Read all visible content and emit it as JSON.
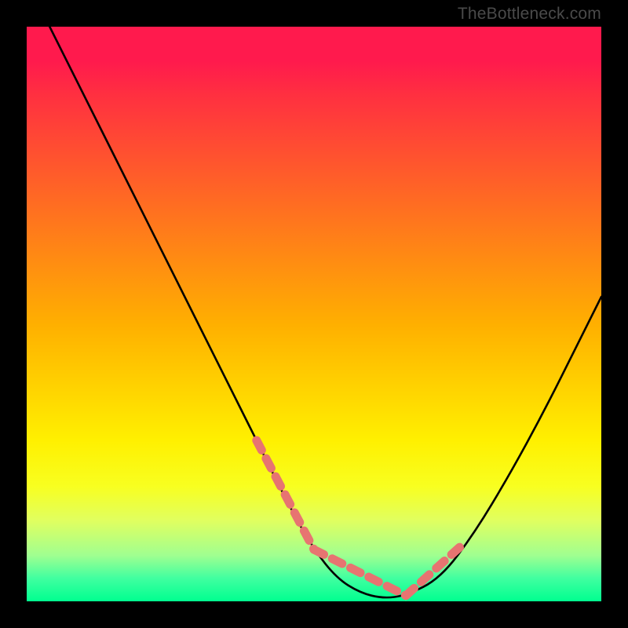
{
  "watermark": "TheBottleneck.com",
  "chart_data": {
    "type": "line",
    "title": "",
    "xlabel": "",
    "ylabel": "",
    "xlim": [
      0,
      100
    ],
    "ylim": [
      0,
      100
    ],
    "series": [
      {
        "name": "main-curve",
        "color": "#000000",
        "x": [
          4,
          10,
          16,
          22,
          28,
          34,
          40,
          46,
          50,
          54,
          58,
          62,
          66,
          72,
          78,
          84,
          90,
          96,
          100
        ],
        "y": [
          100,
          88,
          76,
          64,
          52,
          40,
          28,
          16,
          9,
          4,
          1.5,
          0.5,
          1,
          4,
          12,
          22,
          33,
          45,
          53
        ]
      },
      {
        "name": "highlighted-segments",
        "color": "#e77471",
        "style": "dashed-thick",
        "segments": [
          {
            "x": [
              40,
              50
            ],
            "y": [
              28,
              9
            ]
          },
          {
            "x": [
              50,
              66
            ],
            "y": [
              9,
              1
            ]
          },
          {
            "x": [
              66,
              76
            ],
            "y": [
              1,
              10
            ]
          }
        ]
      }
    ],
    "gradient_background": {
      "top_color": "#ff1a4d",
      "bottom_color": "#00ff90"
    }
  }
}
